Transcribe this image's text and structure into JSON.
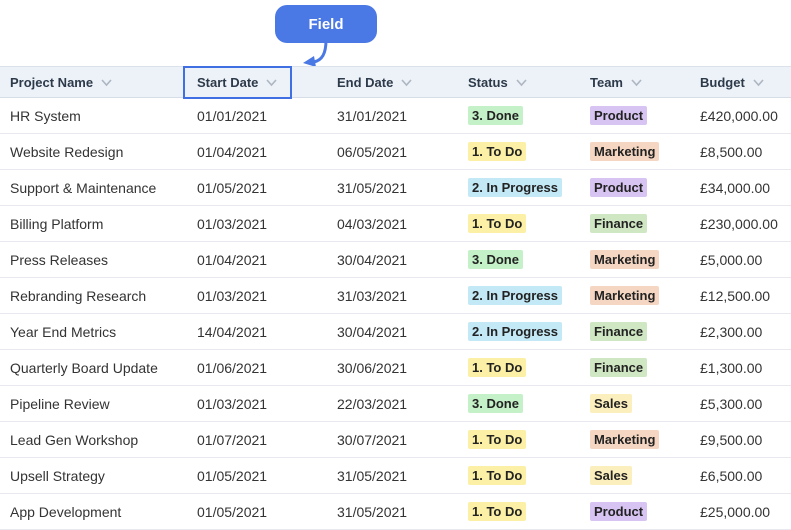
{
  "callout": {
    "label": "Field"
  },
  "columns": [
    "Project Name",
    "Start Date",
    "End Date",
    "Status",
    "Team",
    "Budget"
  ],
  "highlighted_column": "Start Date",
  "status_colors": {
    "1. To Do": "#fbf0a6",
    "2. In Progress": "#c3e8f6",
    "3. Done": "#c4f1c8"
  },
  "team_colors": {
    "Product": "#d7c4f2",
    "Marketing": "#f5d6c2",
    "Finance": "#cfe7c2",
    "Sales": "#fcefbe"
  },
  "rows": [
    {
      "name": "HR System",
      "start": "01/01/2021",
      "end": "31/01/2021",
      "status": "3. Done",
      "team": "Product",
      "budget": "£420,000.00"
    },
    {
      "name": "Website Redesign",
      "start": "01/04/2021",
      "end": "06/05/2021",
      "status": "1. To Do",
      "team": "Marketing",
      "budget": "£8,500.00"
    },
    {
      "name": "Support & Maintenance",
      "start": "01/05/2021",
      "end": "31/05/2021",
      "status": "2. In Progress",
      "team": "Product",
      "budget": "£34,000.00"
    },
    {
      "name": "Billing Platform",
      "start": "01/03/2021",
      "end": "04/03/2021",
      "status": "1. To Do",
      "team": "Finance",
      "budget": "£230,000.00"
    },
    {
      "name": "Press Releases",
      "start": "01/04/2021",
      "end": "30/04/2021",
      "status": "3. Done",
      "team": "Marketing",
      "budget": "£5,000.00"
    },
    {
      "name": "Rebranding Research",
      "start": "01/03/2021",
      "end": "31/03/2021",
      "status": "2. In Progress",
      "team": "Marketing",
      "budget": "£12,500.00"
    },
    {
      "name": "Year End Metrics",
      "start": "14/04/2021",
      "end": "30/04/2021",
      "status": "2. In Progress",
      "team": "Finance",
      "budget": "£2,300.00"
    },
    {
      "name": "Quarterly Board Update",
      "start": "01/06/2021",
      "end": "30/06/2021",
      "status": "1. To Do",
      "team": "Finance",
      "budget": "£1,300.00"
    },
    {
      "name": "Pipeline Review",
      "start": "01/03/2021",
      "end": "22/03/2021",
      "status": "3. Done",
      "team": "Sales",
      "budget": "£5,300.00"
    },
    {
      "name": "Lead Gen Workshop",
      "start": "01/07/2021",
      "end": "30/07/2021",
      "status": "1. To Do",
      "team": "Marketing",
      "budget": "£9,500.00"
    },
    {
      "name": "Upsell Strategy",
      "start": "01/05/2021",
      "end": "31/05/2021",
      "status": "1. To Do",
      "team": "Sales",
      "budget": "£6,500.00"
    },
    {
      "name": "App Development",
      "start": "01/05/2021",
      "end": "31/05/2021",
      "status": "1. To Do",
      "team": "Product",
      "budget": "£25,000.00"
    }
  ]
}
